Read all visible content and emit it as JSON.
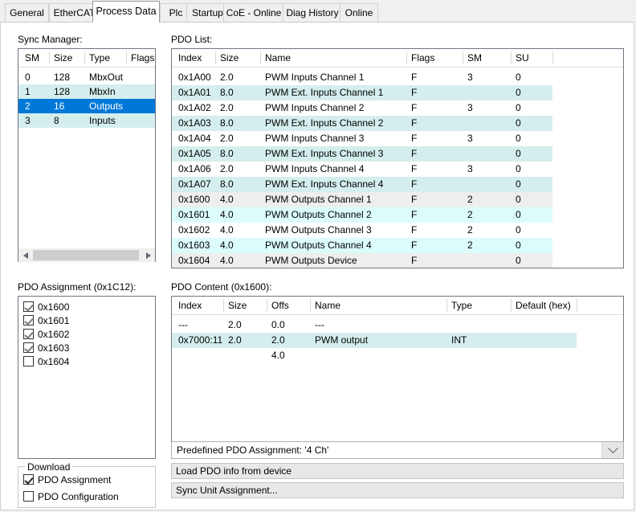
{
  "tabs": [
    {
      "label": "General",
      "active": false
    },
    {
      "label": "EtherCAT",
      "active": false
    },
    {
      "label": "Process Data",
      "active": true
    },
    {
      "label": "Plc",
      "active": false
    },
    {
      "label": "Startup",
      "active": false
    },
    {
      "label": "CoE - Online",
      "active": false
    },
    {
      "label": "Diag History",
      "active": false
    },
    {
      "label": "Online",
      "active": false
    }
  ],
  "sync_manager": {
    "label": "Sync Manager:",
    "columns": [
      "SM",
      "Size",
      "Type",
      "Flags"
    ],
    "rows": [
      {
        "sm": "0",
        "size": "128",
        "type": "MbxOut",
        "flags": "",
        "style": "white"
      },
      {
        "sm": "1",
        "size": "128",
        "type": "MbxIn",
        "flags": "",
        "style": "cyan"
      },
      {
        "sm": "2",
        "size": "16",
        "type": "Outputs",
        "flags": "",
        "style": "selected"
      },
      {
        "sm": "3",
        "size": "8",
        "type": "Inputs",
        "flags": "",
        "style": "cyan"
      }
    ]
  },
  "pdo_list": {
    "label": "PDO List:",
    "columns": [
      "Index",
      "Size",
      "Name",
      "Flags",
      "SM",
      "SU"
    ],
    "rows": [
      {
        "index": "0x1A00",
        "size": "2.0",
        "name": "PWM Inputs Channel 1",
        "flags": "F",
        "sm": "3",
        "su": "0",
        "style": "white"
      },
      {
        "index": "0x1A01",
        "size": "8.0",
        "name": "PWM Ext. Inputs Channel 1",
        "flags": "F",
        "sm": "",
        "su": "0",
        "style": "cyan"
      },
      {
        "index": "0x1A02",
        "size": "2.0",
        "name": "PWM Inputs Channel 2",
        "flags": "F",
        "sm": "3",
        "su": "0",
        "style": "white"
      },
      {
        "index": "0x1A03",
        "size": "8.0",
        "name": "PWM Ext. Inputs Channel 2",
        "flags": "F",
        "sm": "",
        "su": "0",
        "style": "cyan"
      },
      {
        "index": "0x1A04",
        "size": "2.0",
        "name": "PWM Inputs Channel 3",
        "flags": "F",
        "sm": "3",
        "su": "0",
        "style": "white"
      },
      {
        "index": "0x1A05",
        "size": "8.0",
        "name": "PWM Ext. Inputs Channel 3",
        "flags": "F",
        "sm": "",
        "su": "0",
        "style": "cyan"
      },
      {
        "index": "0x1A06",
        "size": "2.0",
        "name": "PWM Inputs Channel 4",
        "flags": "F",
        "sm": "3",
        "su": "0",
        "style": "white"
      },
      {
        "index": "0x1A07",
        "size": "8.0",
        "name": "PWM Ext. Inputs Channel 4",
        "flags": "F",
        "sm": "",
        "su": "0",
        "style": "cyan"
      },
      {
        "index": "0x1600",
        "size": "4.0",
        "name": "PWM Outputs Channel 1",
        "flags": "F",
        "sm": "2",
        "su": "0",
        "style": "grey"
      },
      {
        "index": "0x1601",
        "size": "4.0",
        "name": "PWM Outputs Channel 2",
        "flags": "F",
        "sm": "2",
        "su": "0",
        "style": "brightcyan"
      },
      {
        "index": "0x1602",
        "size": "4.0",
        "name": "PWM Outputs Channel 3",
        "flags": "F",
        "sm": "2",
        "su": "0",
        "style": "white"
      },
      {
        "index": "0x1603",
        "size": "4.0",
        "name": "PWM Outputs Channel 4",
        "flags": "F",
        "sm": "2",
        "su": "0",
        "style": "brightcyan"
      },
      {
        "index": "0x1604",
        "size": "4.0",
        "name": "PWM Outputs Device",
        "flags": "F",
        "sm": "",
        "su": "0",
        "style": "grey"
      }
    ]
  },
  "pdo_assignment": {
    "label": "PDO Assignment (0x1C12):",
    "items": [
      {
        "label": "0x1600",
        "checked": true
      },
      {
        "label": "0x1601",
        "checked": true
      },
      {
        "label": "0x1602",
        "checked": true
      },
      {
        "label": "0x1603",
        "checked": true
      },
      {
        "label": "0x1604",
        "checked": false
      }
    ]
  },
  "pdo_content": {
    "label": "PDO Content (0x1600):",
    "columns": [
      "Index",
      "Size",
      "Offs",
      "Name",
      "Type",
      "Default (hex)"
    ],
    "rows": [
      {
        "index": "---",
        "size": "2.0",
        "offs": "0.0",
        "name": "---",
        "type": "",
        "default": "",
        "style": "white"
      },
      {
        "index": "0x7000:11",
        "size": "2.0",
        "offs": "2.0",
        "name": "PWM output",
        "type": "INT",
        "default": "",
        "style": "cyan"
      },
      {
        "index": "",
        "size": "",
        "offs": "4.0",
        "name": "",
        "type": "",
        "default": "",
        "style": "white"
      }
    ]
  },
  "download": {
    "title": "Download",
    "items": [
      {
        "label": "PDO Assignment",
        "checked": true
      },
      {
        "label": "PDO Configuration",
        "checked": false
      }
    ]
  },
  "bottom": {
    "predefined_combo": "Predefined PDO Assignment: '4 Ch'",
    "load_button": "Load PDO info from device",
    "sync_button": "Sync Unit Assignment..."
  },
  "colors": {
    "selection": "#0078d7",
    "row_cyan": "#d4eeee",
    "row_bright_cyan": "#dcfcfc",
    "row_grey": "#eeeeee"
  }
}
